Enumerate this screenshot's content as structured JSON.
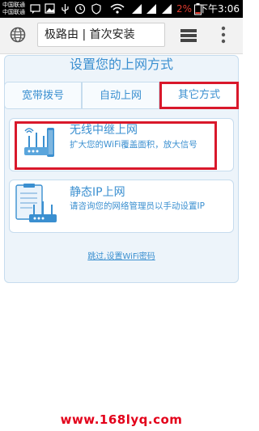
{
  "status_bar": {
    "carrier_1": "中国联通",
    "carrier_2": "中国联通",
    "battery_percent": "2%",
    "time": "下午3:06",
    "icons": [
      "message-icon",
      "image-icon",
      "usb-icon",
      "wifi-icon",
      "signal-icon",
      "signal-icon",
      "battery-icon"
    ]
  },
  "browser": {
    "url_text": "极路由 | 首次安装",
    "icons": [
      "globe-icon",
      "stack-icon",
      "more-icon"
    ]
  },
  "page": {
    "title": "设置您的上网方式",
    "tabs": [
      {
        "label": "宽带拨号"
      },
      {
        "label": "自动上网"
      },
      {
        "label": "其它方式"
      }
    ],
    "options": [
      {
        "title": "无线中继上网",
        "description": "扩大您的WiFi覆盖面积，放大信号",
        "icon": "wireless-repeater-icon"
      },
      {
        "title": "静态IP上网",
        "description": "请咨询您的网络管理员以手动设置IP",
        "icon": "static-ip-icon"
      }
    ],
    "skip_link": "跳过,设置WiFi密码"
  },
  "watermark": "www.168lyq.com",
  "colors": {
    "accent": "#3a8fd0",
    "highlight": "#d9182b",
    "panel_bg": "#edf4fa",
    "watermark": "#e3001a"
  }
}
